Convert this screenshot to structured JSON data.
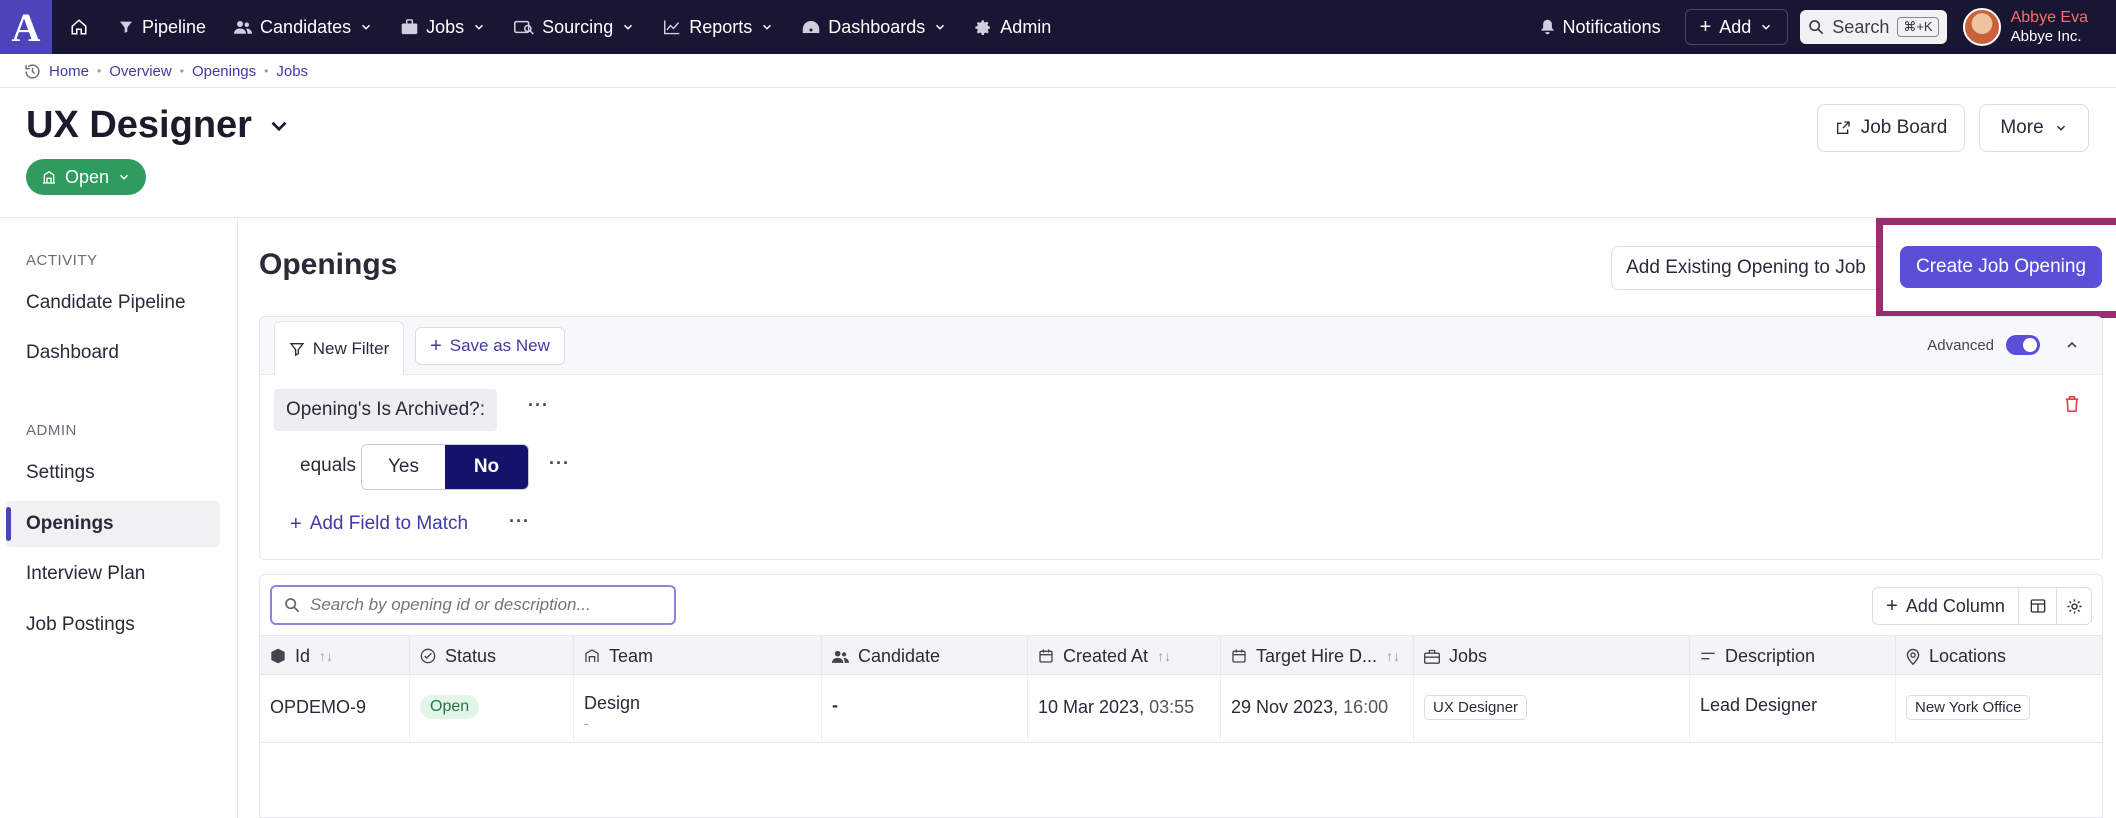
{
  "app": {
    "logo_letter": "A"
  },
  "nav": {
    "items": [
      {
        "label": "Pipeline",
        "icon": "filter-icon",
        "chevron": false
      },
      {
        "label": "Candidates",
        "icon": "people-icon",
        "chevron": true
      },
      {
        "label": "Jobs",
        "icon": "briefcase-icon",
        "chevron": true
      },
      {
        "label": "Sourcing",
        "icon": "sourcing-icon",
        "chevron": true
      },
      {
        "label": "Reports",
        "icon": "chart-icon",
        "chevron": true
      },
      {
        "label": "Dashboards",
        "icon": "gauge-icon",
        "chevron": true
      },
      {
        "label": "Admin",
        "icon": "gear-icon",
        "chevron": false
      }
    ],
    "notifications": "Notifications",
    "add": "Add",
    "search": "Search",
    "shortcut": "⌘+K",
    "user_name": "Abbye Eva",
    "user_org": "Abbye Inc."
  },
  "breadcrumb": [
    "Home",
    "Overview",
    "Openings",
    "Jobs"
  ],
  "header": {
    "title": "UX Designer",
    "status": "Open",
    "job_board": "Job Board",
    "more": "More"
  },
  "sidebar": {
    "section_activity": "ACTIVITY",
    "activity_items": [
      "Candidate Pipeline",
      "Dashboard"
    ],
    "section_admin": "ADMIN",
    "admin_items": [
      "Settings",
      "Openings",
      "Interview Plan",
      "Job Postings"
    ],
    "active": "Openings"
  },
  "main": {
    "title": "Openings",
    "add_existing": "Add Existing Opening to Job",
    "create": "Create Job Opening"
  },
  "filter": {
    "new_filter": "New Filter",
    "save_as_new": "Save as New",
    "advanced": "Advanced",
    "advanced_on": true,
    "condition_field": "Opening's Is Archived?:",
    "operator": "equals",
    "option_yes": "Yes",
    "option_no": "No",
    "selected": "No",
    "add_field": "Add Field to Match"
  },
  "table": {
    "search_placeholder": "Search by opening id or description...",
    "add_column": "Add Column",
    "columns": [
      "Id",
      "Status",
      "Team",
      "Candidate",
      "Created At",
      "Target Hire D...",
      "Jobs",
      "Description",
      "Locations"
    ],
    "rows": [
      {
        "id": "OPDEMO-9",
        "status": "Open",
        "team": "Design",
        "team_sub": "-",
        "candidate": "-",
        "created_date": "10 Mar 2023,",
        "created_time": "03:55",
        "target_date": "29 Nov 2023,",
        "target_time": "16:00",
        "jobs": "UX Designer",
        "description": "Lead Designer",
        "locations": "New York Office"
      }
    ]
  },
  "colors": {
    "nav_bg": "#191633",
    "accent": "#5b4fd8",
    "status_green": "#2e9c5f",
    "highlight": "#9c2d6c",
    "selected_segment": "#12136b"
  }
}
